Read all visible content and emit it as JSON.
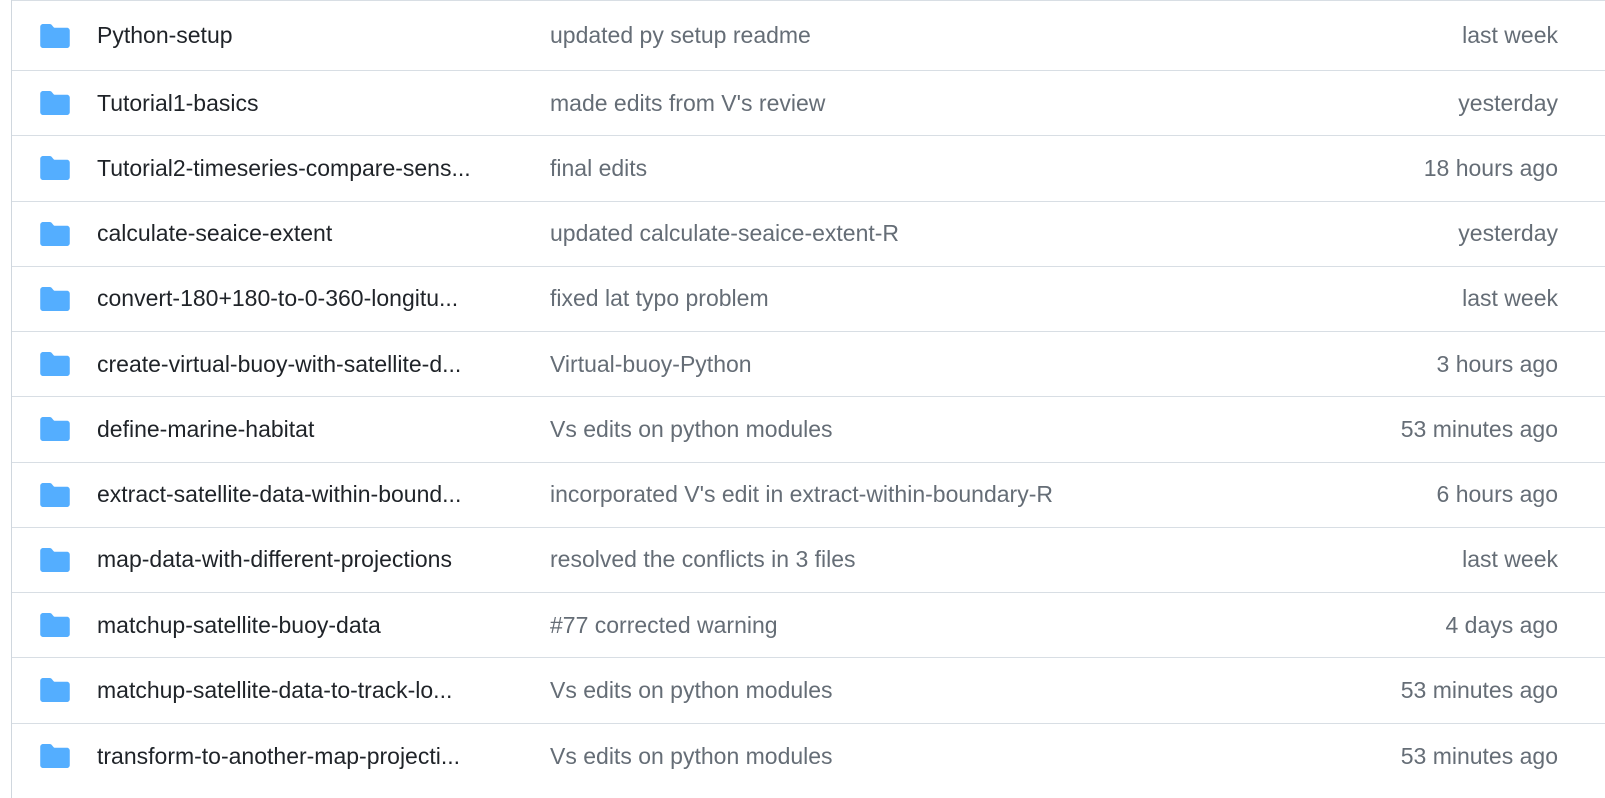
{
  "colors": {
    "folder": "#54aeff",
    "name_text": "#1f2328",
    "muted_text": "#656d76",
    "border": "#d8dee4"
  },
  "rows": [
    {
      "name": "Python-setup",
      "message": "updated py setup readme",
      "age": "last week"
    },
    {
      "name": "Tutorial1-basics",
      "message": "made edits from V's review",
      "age": "yesterday"
    },
    {
      "name": "Tutorial2-timeseries-compare-sens...",
      "message": "final edits",
      "age": "18 hours ago"
    },
    {
      "name": "calculate-seaice-extent",
      "message": "updated calculate-seaice-extent-R",
      "age": "yesterday"
    },
    {
      "name": "convert-180+180-to-0-360-longitu...",
      "message": "fixed lat typo problem",
      "age": "last week"
    },
    {
      "name": "create-virtual-buoy-with-satellite-d...",
      "message": "Virtual-buoy-Python",
      "age": "3 hours ago"
    },
    {
      "name": "define-marine-habitat",
      "message": "Vs edits on python modules",
      "age": "53 minutes ago"
    },
    {
      "name": "extract-satellite-data-within-bound...",
      "message": "incorporated V's edit in extract-within-boundary-R",
      "age": "6 hours ago"
    },
    {
      "name": "map-data-with-different-projections",
      "message": "resolved the conflicts in 3 files",
      "age": "last week"
    },
    {
      "name": "matchup-satellite-buoy-data",
      "message": "#77 corrected warning",
      "age": "4 days ago"
    },
    {
      "name": "matchup-satellite-data-to-track-lo...",
      "message": "Vs edits on python modules",
      "age": "53 minutes ago"
    },
    {
      "name": "transform-to-another-map-projecti...",
      "message": "Vs edits on python modules",
      "age": "53 minutes ago"
    }
  ]
}
